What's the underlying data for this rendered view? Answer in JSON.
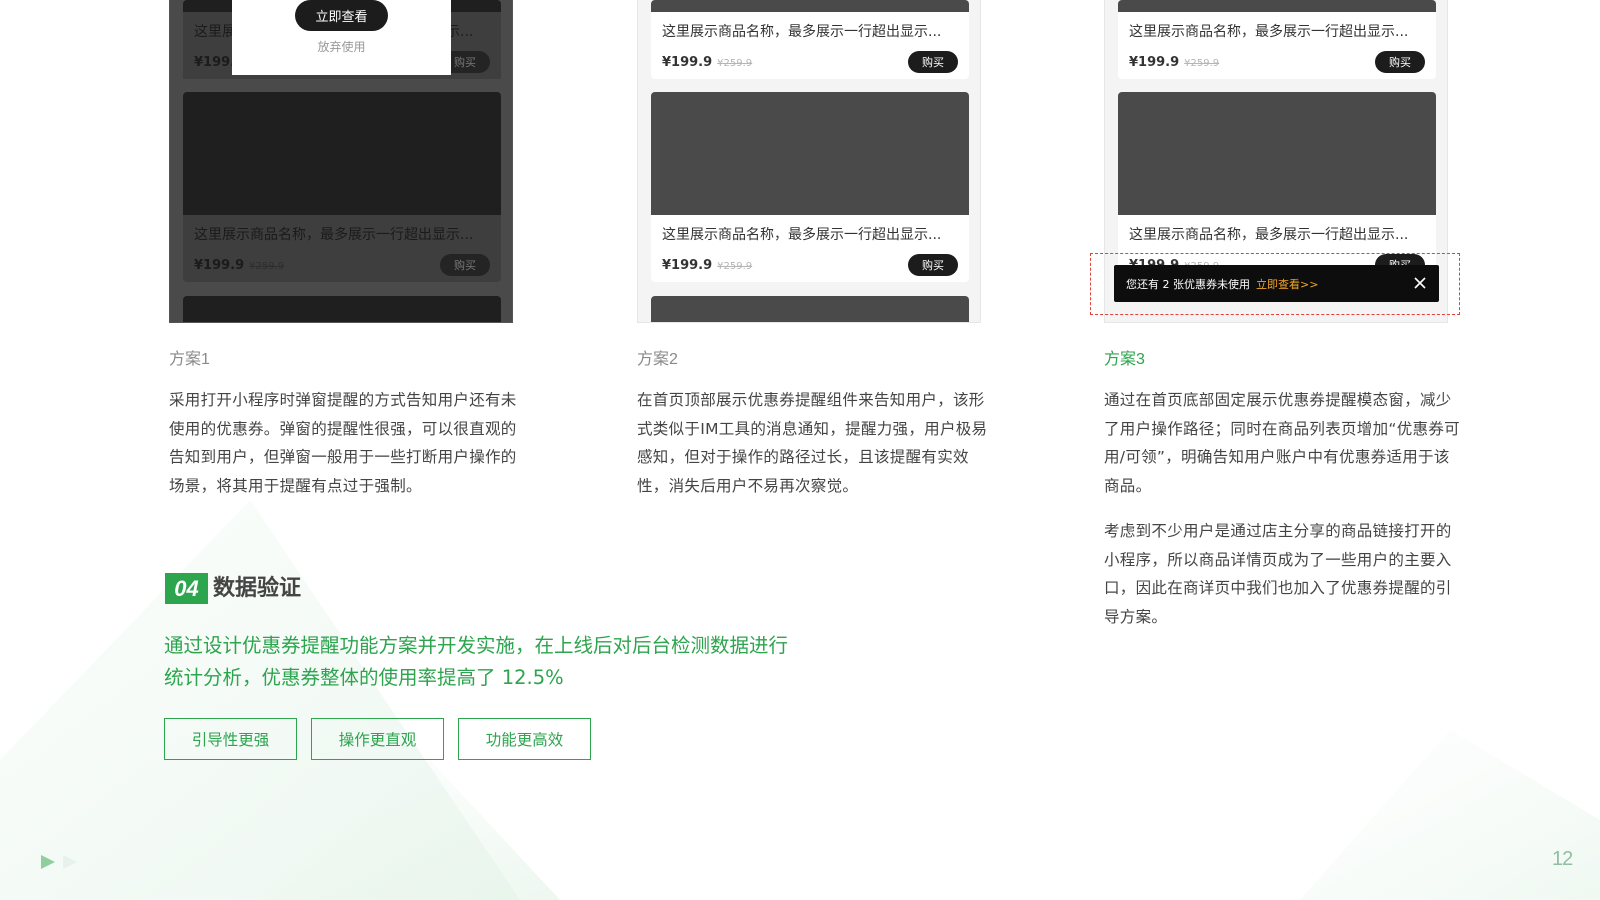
{
  "mockups": {
    "product_name": "这里展示商品名称，最多展示一行超出显示...",
    "price": "¥199.9",
    "old_price": "¥259.9",
    "buy_label": "购买",
    "modal": {
      "view_label": "立即查看",
      "skip_label": "放弃使用"
    },
    "float_bar": {
      "text": "您还有 2 张优惠券未使用",
      "link": "立即查看>>"
    }
  },
  "plans": [
    {
      "title": "方案1",
      "desc": "采用打开小程序时弹窗提醒的方式告知用户还有未使用的优惠券。弹窗的提醒性很强，可以很直观的告知到用户，但弹窗一般用于一些打断用户操作的场景，将其用于提醒有点过于强制。"
    },
    {
      "title": "方案2",
      "desc": "在首页顶部展示优惠券提醒组件来告知用户，该形式类似于IM工具的消息通知，提醒力强，用户极易感知，但对于操作的路径过长，且该提醒有实效性，消失后用户不易再次察觉。"
    },
    {
      "title": "方案3",
      "desc": "通过在首页底部固定展示优惠券提醒模态窗，减少了用户操作路径；同时在商品列表页增加“优惠券可用/可领”，明确告知用户账户中有优惠券适用于该商品。",
      "desc2": "考虑到不少用户是通过店主分享的商品链接打开的小程序，所以商品详情页成为了一些用户的主要入口，因此在商详页中我们也加入了优惠券提醒的引导方案。"
    }
  ],
  "section": {
    "number": "04",
    "title": "数据验证",
    "summary_line1": "通过设计优惠券提醒功能方案并开发实施，在上线后对后台检测数据进行",
    "summary_line2": "统计分析，优惠券整体的使用率提高了 12.5%",
    "tags": [
      "引导性更强",
      "操作更直观",
      "功能更高效"
    ]
  },
  "page_number": "12",
  "colors": {
    "accent": "#2da44e",
    "warning": "#f5a623",
    "dashed": "#e0413a"
  }
}
